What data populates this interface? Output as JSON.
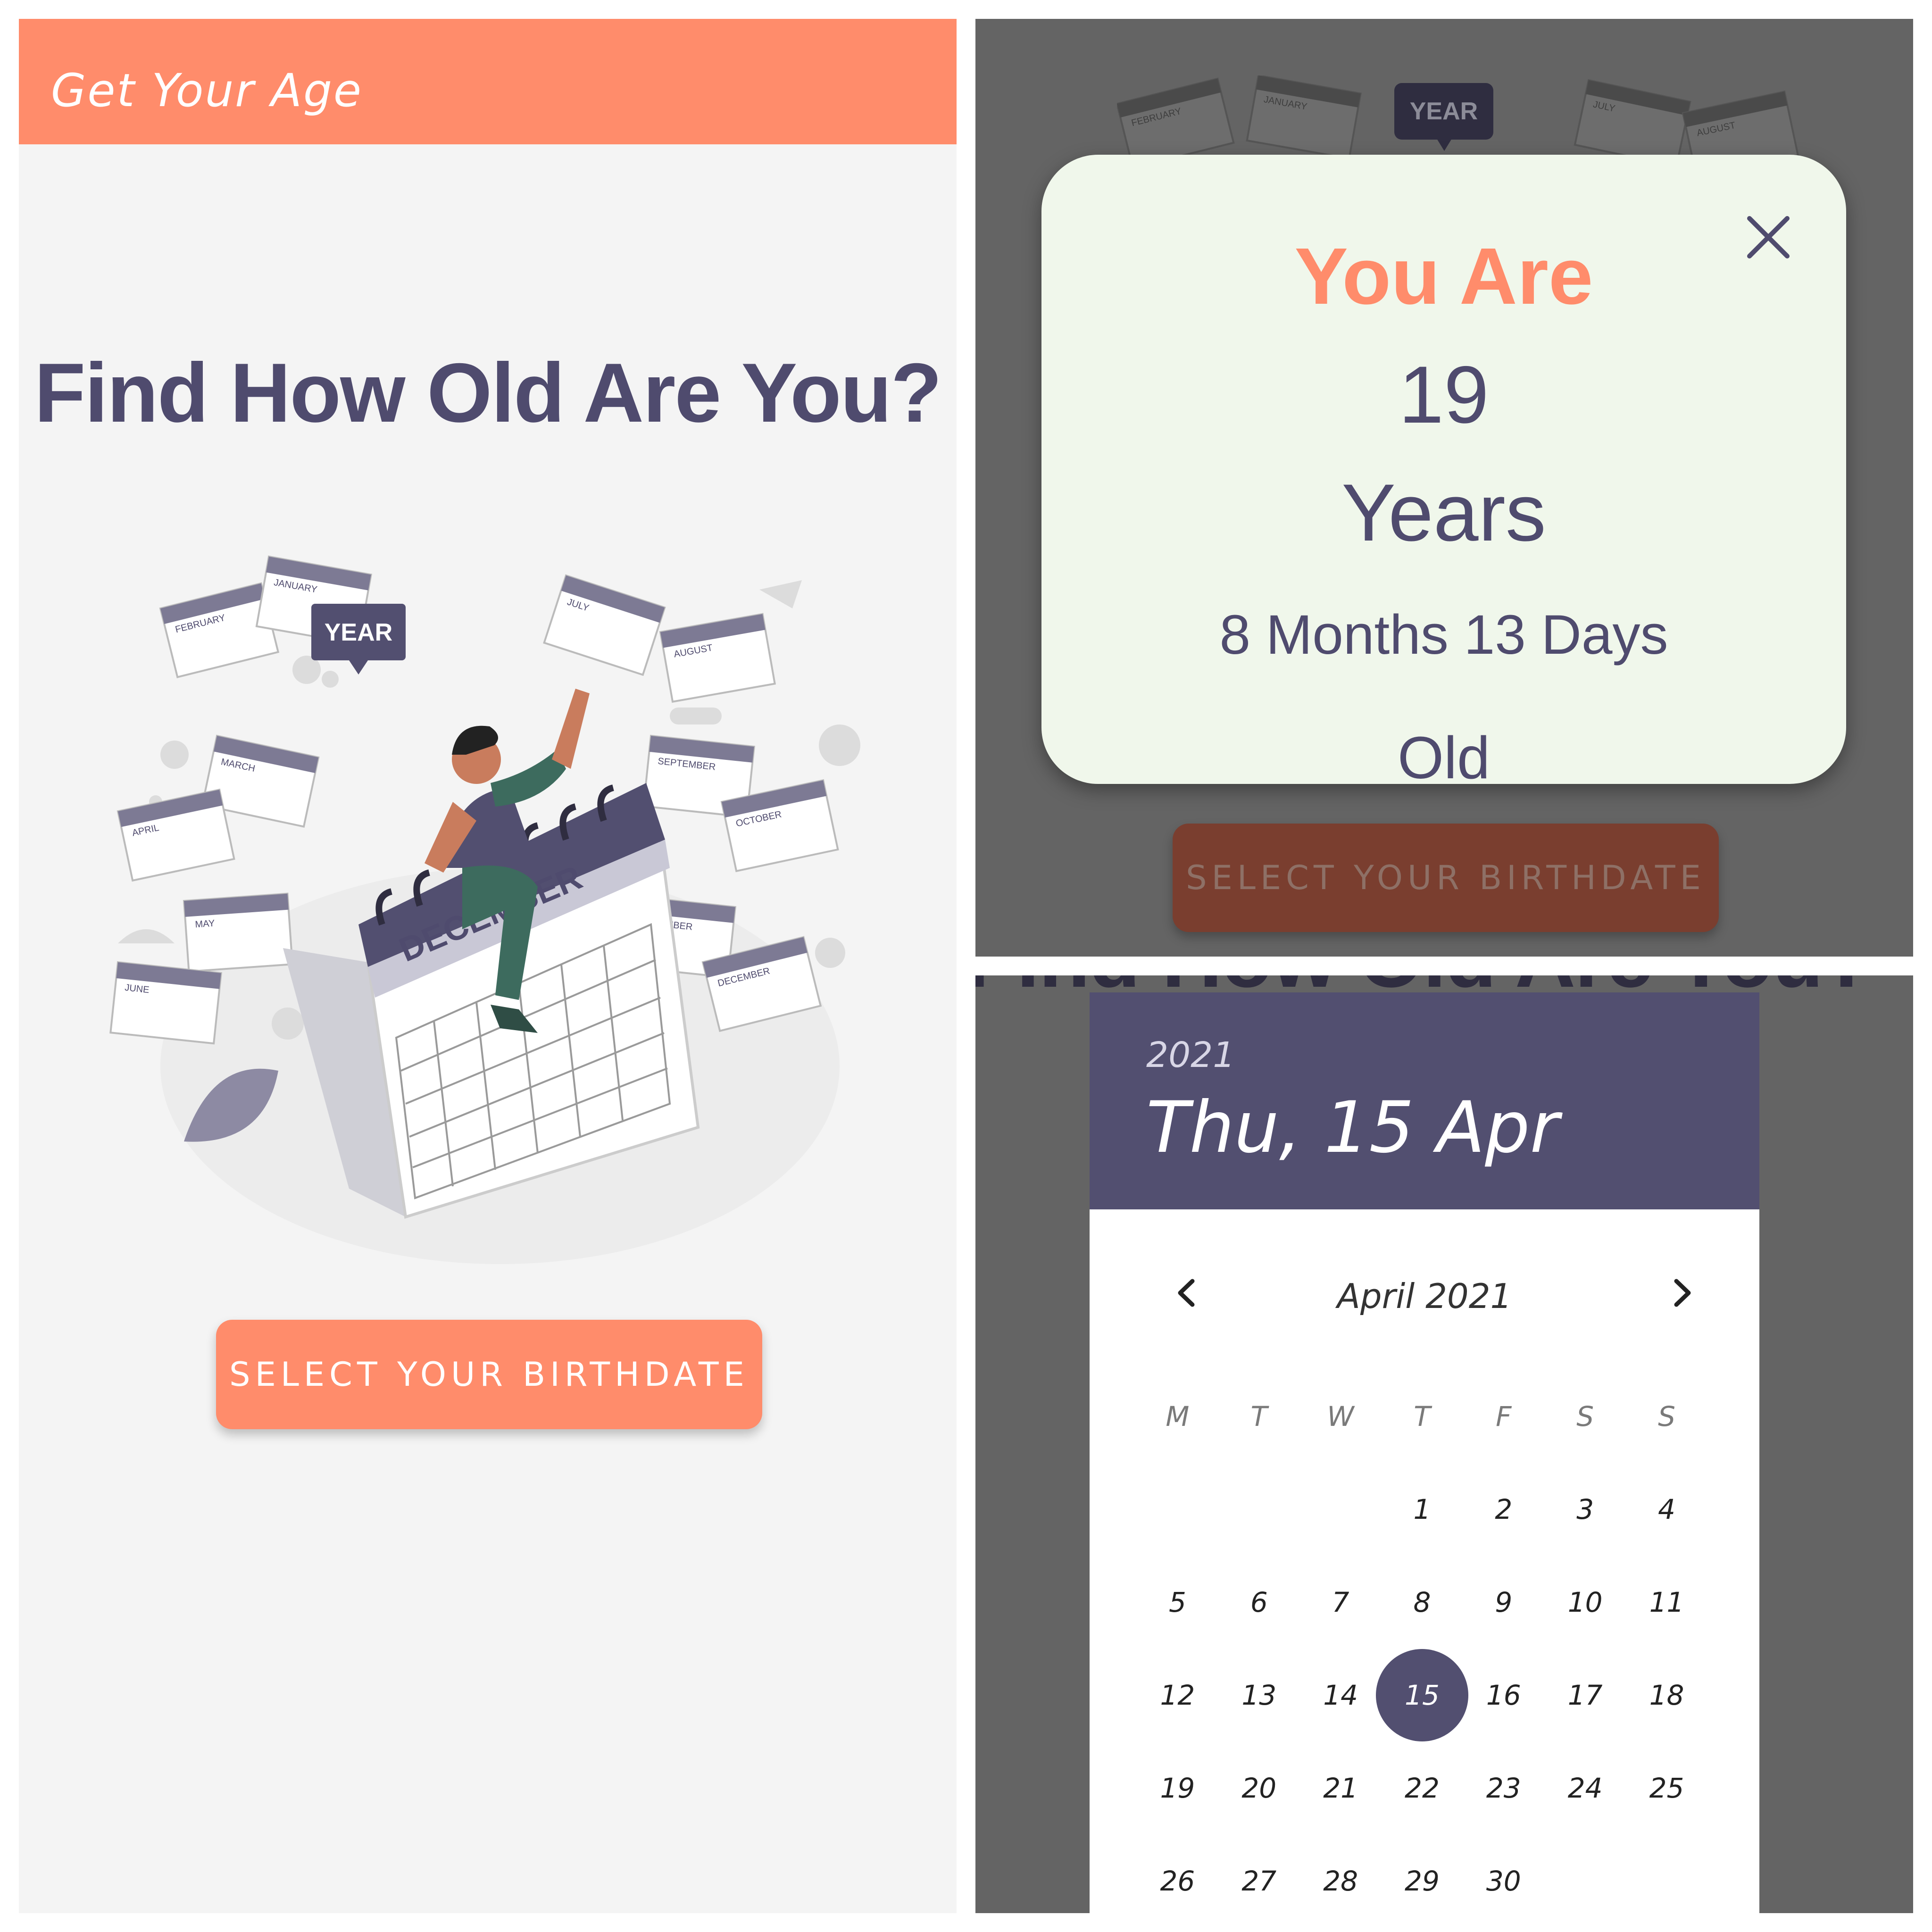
{
  "screen_main": {
    "app_title": "Get Your Age",
    "headline": "Find How Old Are You?",
    "illustration": {
      "badge_text": "YEAR",
      "calendar_label": "DECEMBER",
      "month_cards": [
        "JANUARY",
        "FEBRUARY",
        "MARCH",
        "APRIL",
        "MAY",
        "JUNE",
        "JULY",
        "AUGUST",
        "SEPTEMBER",
        "OCTOBER",
        "NOVEMBER",
        "DECEMBER"
      ]
    },
    "select_button_label": "SELECT YOUR BIRTHDATE"
  },
  "screen_result": {
    "background_badge": "YEAR",
    "background_cards": [
      "FEBRUARY",
      "JANUARY",
      "JULY",
      "AUGUST"
    ],
    "dialog": {
      "line1": "You Are",
      "years_value": "19",
      "years_word": "Years",
      "months_days": "8 Months 13 Days",
      "suffix": "Old",
      "close_icon": "close-icon"
    },
    "select_button_label": "SELECT YOUR BIRTHDATE"
  },
  "screen_picker": {
    "background_headline": "Find How Old Are You?",
    "header_year": "2021",
    "header_date": "Thu, 15 Apr",
    "month_label": "April 2021",
    "prev_icon": "chevron-left-icon",
    "next_icon": "chevron-right-icon",
    "weekdays": [
      "M",
      "T",
      "W",
      "T",
      "F",
      "S",
      "S"
    ],
    "days": [
      "",
      "",
      "",
      "1",
      "2",
      "3",
      "4",
      "5",
      "6",
      "7",
      "8",
      "9",
      "10",
      "11",
      "12",
      "13",
      "14",
      "15",
      "16",
      "17",
      "18",
      "19",
      "20",
      "21",
      "22",
      "23",
      "24",
      "25",
      "26",
      "27",
      "28",
      "29",
      "30",
      "",
      ""
    ],
    "selected_day": "15"
  },
  "colors": {
    "accent": "#ff8c6b",
    "primary": "#524f70",
    "text_dark": "#4f4b6e",
    "dialog_bg": "#f0f7eb",
    "scrim": "#646464"
  }
}
